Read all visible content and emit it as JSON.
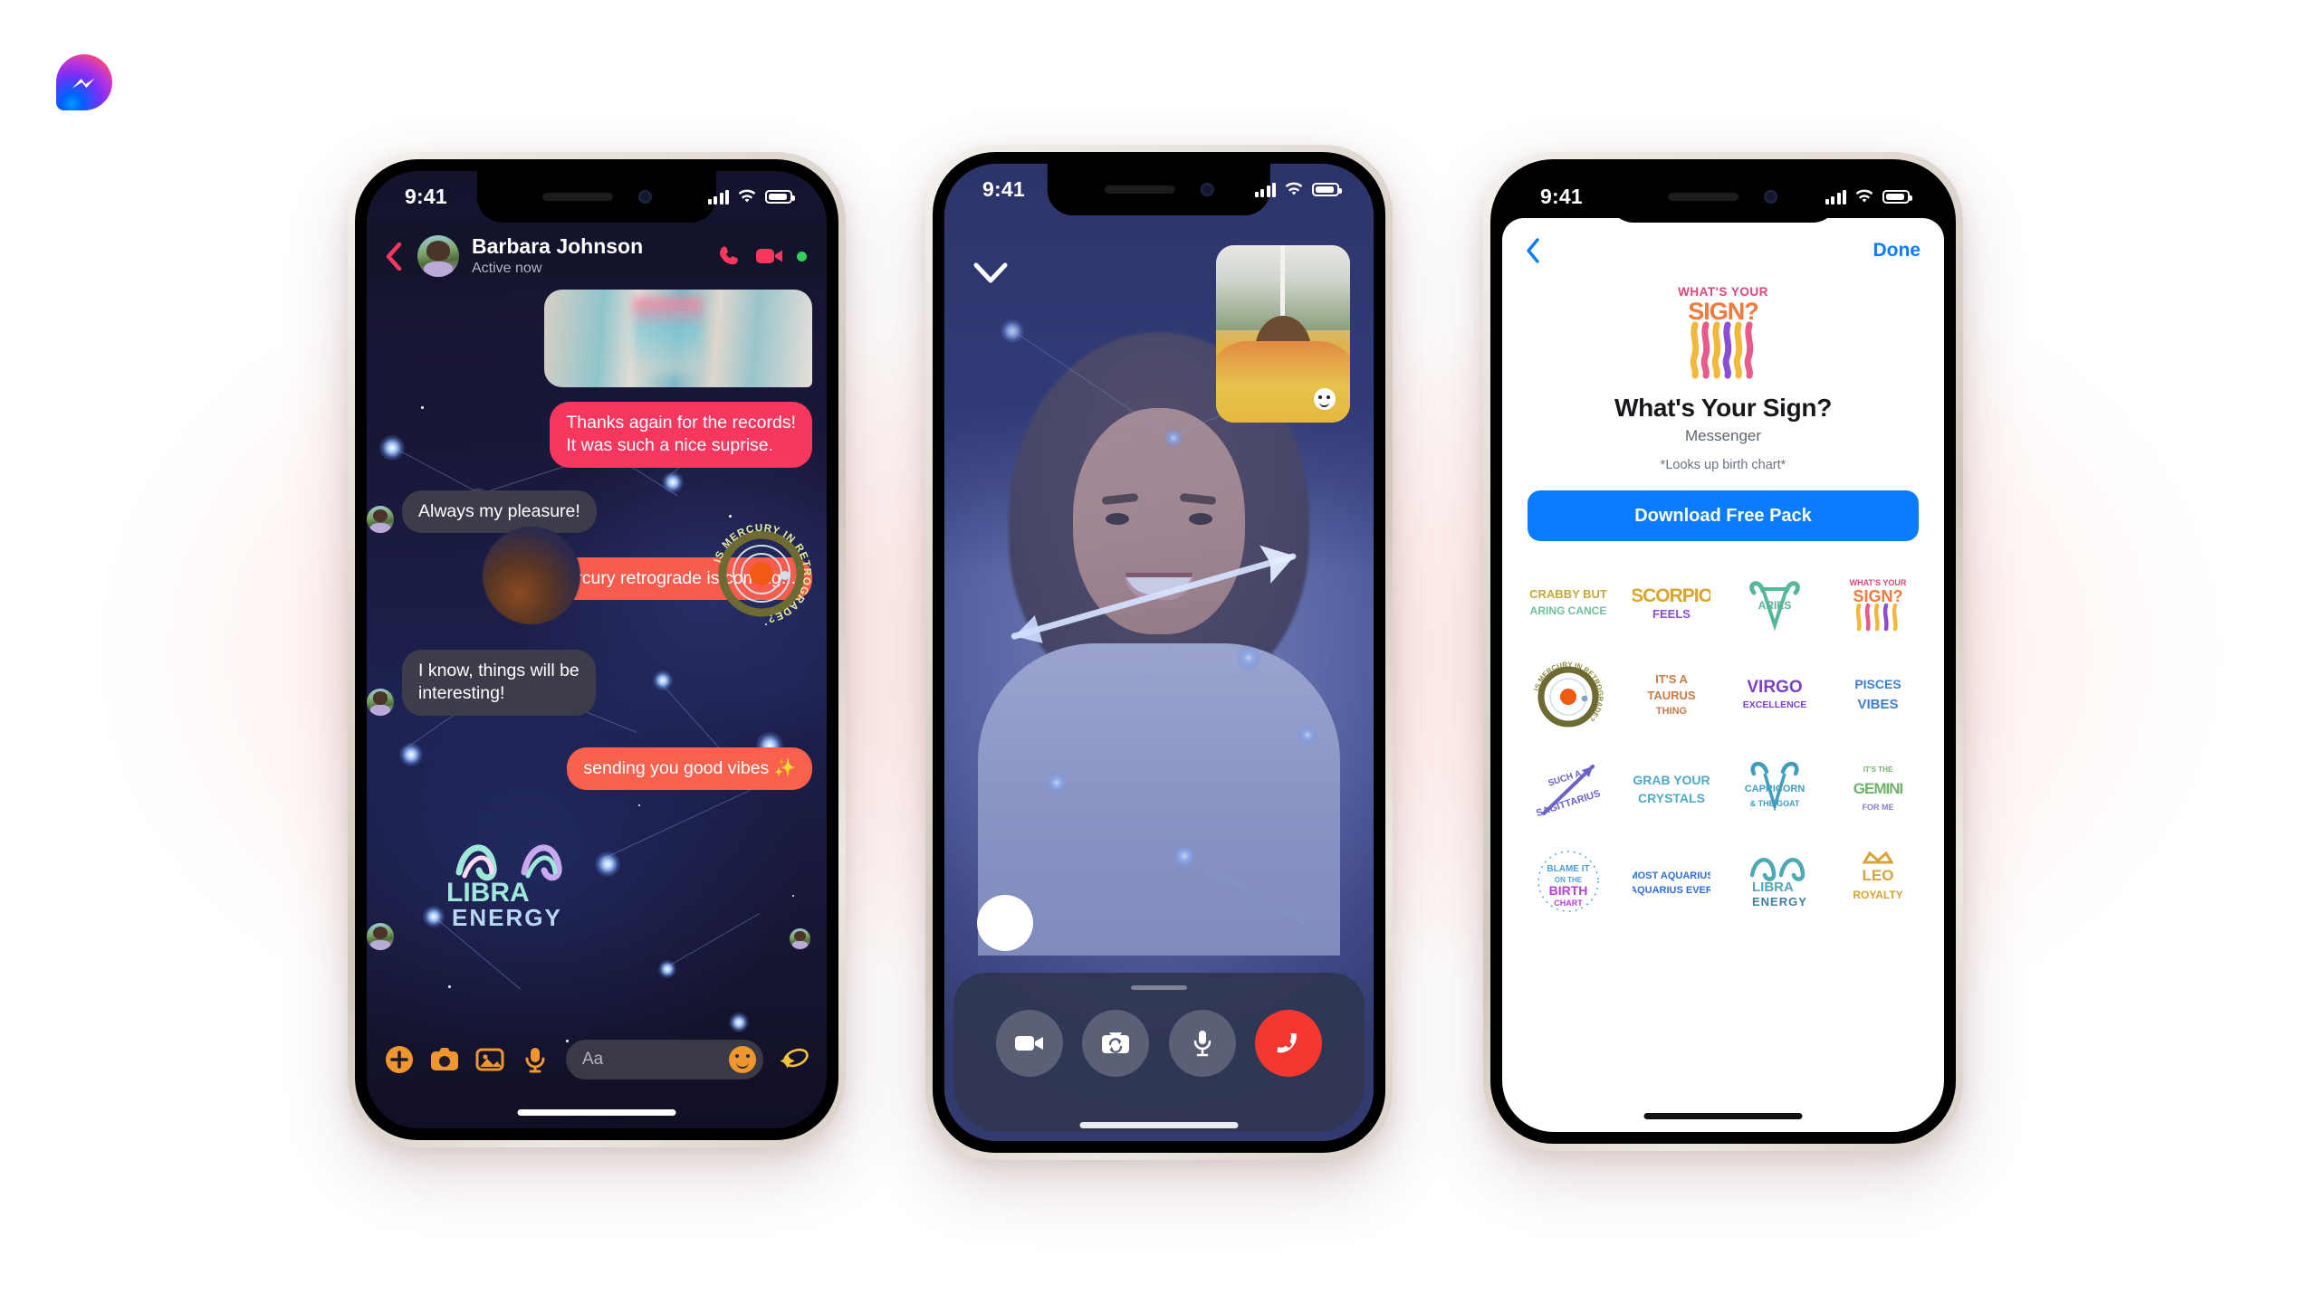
{
  "brand": {
    "name": "Messenger",
    "logo_icon": "messenger-logo",
    "logo_colors": [
      "#0099ff",
      "#7a2ff7",
      "#ff4f6e"
    ]
  },
  "phone1": {
    "status_bar": {
      "time": "9:41",
      "signal_icon": "cellular-bars-icon",
      "wifi_icon": "wifi-icon",
      "battery_icon": "battery-icon"
    },
    "header": {
      "back_icon": "back-chevron-icon",
      "avatar_icon": "contact-avatar",
      "name": "Barbara Johnson",
      "status": "Active now",
      "audio_call_icon": "phone-call-icon",
      "video_call_icon": "video-camera-icon",
      "online_indicator": "online-dot",
      "accent": "#f8375f"
    },
    "messages": [
      {
        "id": "photo",
        "type": "image",
        "side": "out",
        "alt": "shared photo"
      },
      {
        "id": "m1",
        "type": "text",
        "side": "out",
        "color": "pink",
        "text": "Thanks again for the records!\nIt was such a nice suprise."
      },
      {
        "id": "m2",
        "type": "text",
        "side": "in",
        "color": "grey",
        "text": "Always my pleasure!"
      },
      {
        "id": "m3",
        "type": "text",
        "side": "out",
        "color": "coral",
        "text": "mercury retrograde is coming..."
      },
      {
        "id": "m4",
        "type": "sticker",
        "side": "in",
        "sticker": "IS MERCURY IN RETROGRADE?"
      },
      {
        "id": "m5",
        "type": "text",
        "side": "in",
        "color": "grey",
        "text": "I know, things will be\ninteresting!"
      },
      {
        "id": "m6",
        "type": "text",
        "side": "out",
        "color": "salmon",
        "text": "sending you good vibes ✨"
      },
      {
        "id": "m7",
        "type": "sticker",
        "side": "in",
        "sticker": "LIBRA ENERGY"
      }
    ],
    "message_text": {
      "m1_line1": "Thanks again for the records!",
      "m1_line2": "It was such a nice suprise.",
      "m2": "Always my pleasure!",
      "m3": "mercury retrograde is coming...",
      "m5_line1": "I know, things will be",
      "m5_line2": "interesting!",
      "m6": "sending you good vibes ✨"
    },
    "stickers": {
      "mercury": "IS MERCURY IN RETROGRADE?",
      "libra_top": "LIBRA",
      "libra_bottom": "ENERGY"
    },
    "toolbar": {
      "icons": [
        "plus-circle-icon",
        "camera-icon",
        "photo-gallery-icon",
        "microphone-icon"
      ],
      "input_placeholder": "Aa",
      "emoji_icon": "smiley-emoji-icon",
      "effects_icon": "magic-wand-star-icon",
      "accent": "#f0962e"
    }
  },
  "phone2": {
    "status_bar": {
      "time": "9:41",
      "signal_icon": "cellular-bars-icon",
      "wifi_icon": "wifi-icon",
      "battery_icon": "battery-icon"
    },
    "collapse_icon": "chevron-down-icon",
    "self_view": {
      "label": "self-view-pip",
      "effect_badge_icon": "sparkle-face-icon"
    },
    "ar_effect": {
      "name": "sagittarius-arrow-effect",
      "overlay_icon": "arrow-constellation-icon"
    },
    "shutter_icon": "capture-shutter-button",
    "controls": [
      {
        "name": "toggle-video-button",
        "icon": "video-camera-icon"
      },
      {
        "name": "flip-camera-button",
        "icon": "camera-flip-icon"
      },
      {
        "name": "mute-mic-button",
        "icon": "microphone-icon"
      },
      {
        "name": "end-call-button",
        "icon": "end-call-handset-icon",
        "color": "#f5382f"
      }
    ]
  },
  "phone3": {
    "status_bar": {
      "time": "9:41",
      "signal_icon": "cellular-bars-icon",
      "wifi_icon": "wifi-icon",
      "battery_icon": "battery-icon"
    },
    "nav": {
      "back_icon": "back-chevron-icon",
      "done_label": "Done",
      "accent": "#0a7cff"
    },
    "pack": {
      "hero_icon": "whats-your-sign-hero-sticker",
      "title": "What's Your Sign?",
      "subtitle": "Messenger",
      "note": "*Looks up birth chart*",
      "download_label": "Download Free Pack"
    },
    "stickers": [
      {
        "id": "s1",
        "text": "CRABBY BUT CARING CANCER",
        "icon": "sticker-cancer",
        "color": "#c6a63a"
      },
      {
        "id": "s2",
        "text": "SCORPIO FEELS",
        "icon": "sticker-scorpio",
        "color": "#d9a52b"
      },
      {
        "id": "s3",
        "text": "ARIES",
        "icon": "sticker-aries",
        "color": "#56b89a"
      },
      {
        "id": "s4",
        "text": "WHAT'S YOUR SIGN?",
        "icon": "sticker-whats-your-sign",
        "color": "#f0a03a"
      },
      {
        "id": "s5",
        "text": "IS MERCURY IN RETROGRADE?",
        "icon": "sticker-mercury-retrograde",
        "color": "#8d8c3e"
      },
      {
        "id": "s6",
        "text": "IT'S A TAURUS THING",
        "icon": "sticker-taurus",
        "color": "#c87a47"
      },
      {
        "id": "s7",
        "text": "VIRGO EXCELLENCE",
        "icon": "sticker-virgo",
        "color": "#7b3fd0"
      },
      {
        "id": "s8",
        "text": "PISCES VIBES",
        "icon": "sticker-pisces",
        "color": "#3f7fd0"
      },
      {
        "id": "s9",
        "text": "SUCH A SAGITTARIUS",
        "icon": "sticker-sagittarius",
        "color": "#6b63c8"
      },
      {
        "id": "s10",
        "text": "GRAB YOUR CRYSTALS",
        "icon": "sticker-crystals",
        "color": "#4fa8c8"
      },
      {
        "id": "s11",
        "text": "CAPRICORN & THE GOAT",
        "icon": "sticker-capricorn",
        "color": "#3f9ec0"
      },
      {
        "id": "s12",
        "text": "IT'S THE GEMINI FOR ME",
        "icon": "sticker-gemini",
        "color": "#6fb36a"
      },
      {
        "id": "s13",
        "text": "BLAME IT ON THE BIRTH CHART",
        "icon": "sticker-birth-chart",
        "color": "#b43fd0"
      },
      {
        "id": "s14",
        "text": "MOST AQUARIUS AQUARIUS EVER",
        "icon": "sticker-aquarius",
        "color": "#2f6fd8"
      },
      {
        "id": "s15",
        "text": "LIBRA ENERGY",
        "icon": "sticker-libra",
        "color": "#4fa8b8"
      },
      {
        "id": "s16",
        "text": "LEO ROYALTY",
        "icon": "sticker-leo",
        "color": "#d8a33a"
      }
    ]
  }
}
